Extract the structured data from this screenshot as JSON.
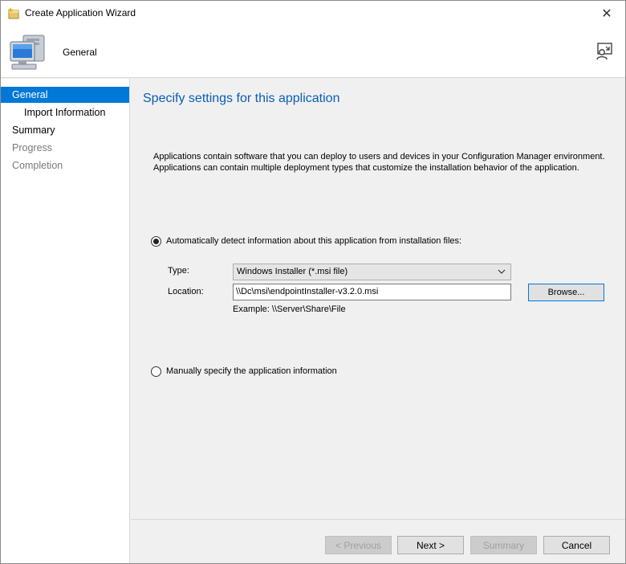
{
  "window": {
    "title": "Create Application Wizard",
    "close_glyph": "✕"
  },
  "header": {
    "title": "General",
    "icon": "computer-icon",
    "feedback_icon": "feedback-icon"
  },
  "sidebar": {
    "items": [
      {
        "label": "General",
        "state": "active"
      },
      {
        "label": "Import Information",
        "state": "sub"
      },
      {
        "label": "Summary",
        "state": "normal"
      },
      {
        "label": "Progress",
        "state": "disabled"
      },
      {
        "label": "Completion",
        "state": "disabled"
      }
    ]
  },
  "main": {
    "heading": "Specify settings for this application",
    "description_line1": "Applications contain software that you can deploy to users and devices in your Configuration Manager environment.",
    "description_line2": "Applications can contain multiple deployment types that customize the installation behavior of the application.",
    "auto_detect_label": "Automatically detect information about this application from installation files:",
    "auto_detect_checked": true,
    "type_label": "Type:",
    "type_value": "Windows Installer (*.msi file)",
    "location_label": "Location:",
    "location_value": "\\\\Dc\\msi\\endpointInstaller-v3.2.0.msi",
    "browse_label": "Browse...",
    "example": "Example: \\\\Server\\Share\\File",
    "manual_label": "Manually specify the application information",
    "manual_checked": false
  },
  "footer": {
    "previous_label": "< Previous",
    "next_label": "Next >",
    "summary_label": "Summary",
    "cancel_label": "Cancel"
  },
  "colors": {
    "accent": "#0078d7",
    "heading": "#0a5eb8"
  }
}
